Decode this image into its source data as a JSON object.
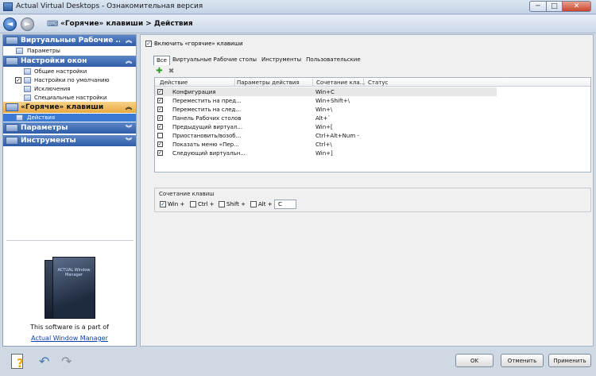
{
  "window": {
    "title": "Actual Virtual Desktops - Ознакомительная версия",
    "minimize": "─",
    "maximize": "□",
    "close": "✕"
  },
  "nav": {
    "back_glyph": "◄",
    "forward_glyph": "►",
    "breadcrumb_icon": "⌨",
    "breadcrumb": "«Горячие» клавиши > Действия"
  },
  "sidebar": {
    "groups": [
      {
        "label": "Виртуальные Рабочие ...",
        "chevron": "︽",
        "items": [
          {
            "label": "Параметры"
          }
        ]
      },
      {
        "label": "Настройки окон",
        "chevron": "︽",
        "items": [
          {
            "label": "Общие настройки"
          },
          {
            "label": "Настройки по умолчанию",
            "checkbox": "✓"
          },
          {
            "label": "Исключения"
          },
          {
            "label": "Специальные настройки"
          }
        ]
      },
      {
        "label": "«Горячие» клавиши",
        "chevron": "︽",
        "items": [
          {
            "label": "Действия"
          }
        ]
      },
      {
        "label": "Параметры",
        "chevron": "︾"
      },
      {
        "label": "Инструменты",
        "chevron": "︾"
      }
    ],
    "software_text": "This software is a part of",
    "software_link": "Actual Window Manager",
    "box_brand": "ACTUAL Window Manager"
  },
  "main": {
    "enable_checkbox": "✓",
    "enable_label": "Включить «горячие» клавиши",
    "tabs": [
      {
        "label": "Все"
      },
      {
        "label": "Виртуальные Рабочие столы"
      },
      {
        "label": "Инструменты"
      },
      {
        "label": "Пользовательские"
      }
    ],
    "add_glyph": "✚",
    "delete_glyph": "✖",
    "columns": [
      "Действие",
      "Параметры действия",
      "Сочетание кла...",
      "Статус"
    ],
    "rows": [
      {
        "check": "✓",
        "action": "Конфигурация",
        "hotkey": "Win+C"
      },
      {
        "check": "✓",
        "action": "Переместить на пред...",
        "hotkey": "Win+Shift+\\"
      },
      {
        "check": "✓",
        "action": "Переместить на след...",
        "hotkey": "Win+\\"
      },
      {
        "check": "✓",
        "action": "Панель Рабочих столов",
        "hotkey": "Alt+`"
      },
      {
        "check": "✓",
        "action": "Предыдущий виртуал...",
        "hotkey": "Win+["
      },
      {
        "check": "",
        "action": "Приостановить/возоб...",
        "hotkey": "Ctrl+Alt+Num -"
      },
      {
        "check": "✓",
        "action": "Показать меню «Пер...",
        "hotkey": "Ctrl+\\"
      },
      {
        "check": "✓",
        "action": "Следующий виртуальн...",
        "hotkey": "Win+]"
      }
    ],
    "hotkey_group_label": "Сочетание клавиш",
    "modifiers": [
      {
        "label": "Win +",
        "check": "✓"
      },
      {
        "label": "Ctrl +",
        "check": ""
      },
      {
        "label": "Shift +",
        "check": ""
      },
      {
        "label": "Alt +",
        "check": ""
      }
    ],
    "key_value": "C"
  },
  "footer": {
    "help_glyph": "?",
    "undo_glyph": "↶",
    "redo_glyph": "↷",
    "ok": "OK",
    "cancel": "Отменить",
    "apply": "Применить"
  }
}
